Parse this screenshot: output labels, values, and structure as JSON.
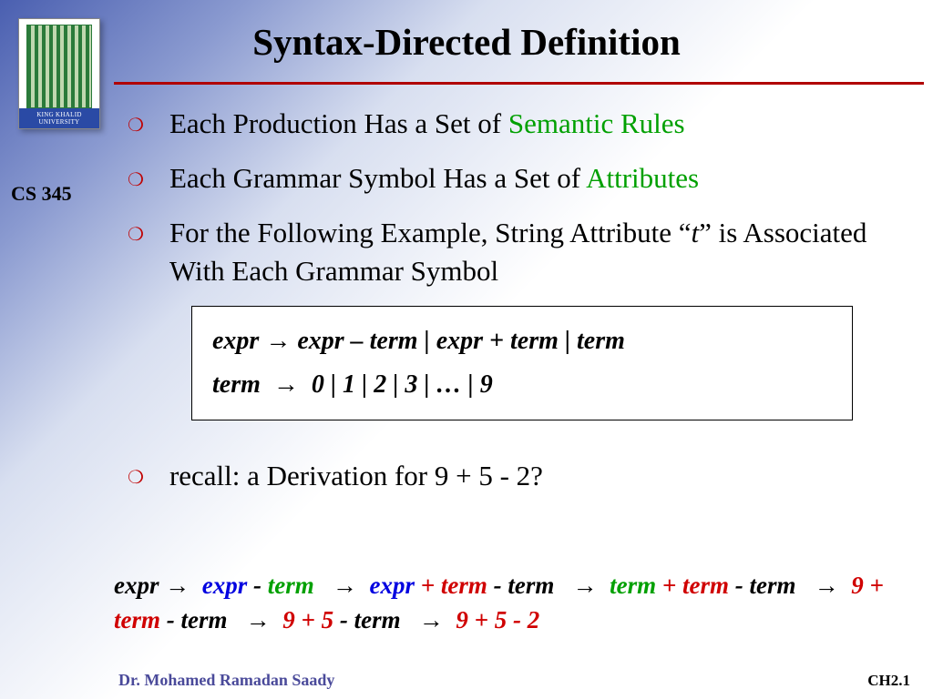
{
  "title": "Syntax-Directed Definition",
  "course": "CS 345",
  "logo_text": "KING KHALID UNIVERSITY",
  "bullets": [
    {
      "pre": "Each Production Has a Set of ",
      "hl": "Semantic Rules",
      "post": ""
    },
    {
      "pre": "Each Grammar Symbol Has a Set of ",
      "hl": "Attributes",
      "post": ""
    },
    {
      "pre": "For the Following Example, String Attribute “",
      "hl_i": "t",
      "post": "” is Associated With Each Grammar Symbol"
    }
  ],
  "grammar": {
    "line1_lhs": "expr",
    "line1_rhs": "expr – term | expr + term | term",
    "line2_lhs": "term",
    "line2_rhs": "0 | 1 | 2 | 3 | … | 9"
  },
  "recall": "recall: a Derivation for  9 + 5  -  2?",
  "derivation": {
    "s1_lhs": "expr",
    "s1_rhs_b": "expr",
    "s1_rhs_op": " - ",
    "s1_rhs_g": "term",
    "s2_b": "expr",
    "s2_r": " + term",
    "s2_tail": " - term",
    "s3_g": "term",
    "s3_r": " + term",
    "s3_tail": " - term",
    "s4_num": "9",
    "s4_r": " + term",
    "s4_tail": " - term",
    "s5_a": "9 + 5",
    "s5_tail": " - term",
    "s6": "9 + 5 - 2"
  },
  "footer": {
    "author": "Dr. Mohamed Ramadan Saady",
    "page": "CH2.1"
  },
  "arrow": "→"
}
